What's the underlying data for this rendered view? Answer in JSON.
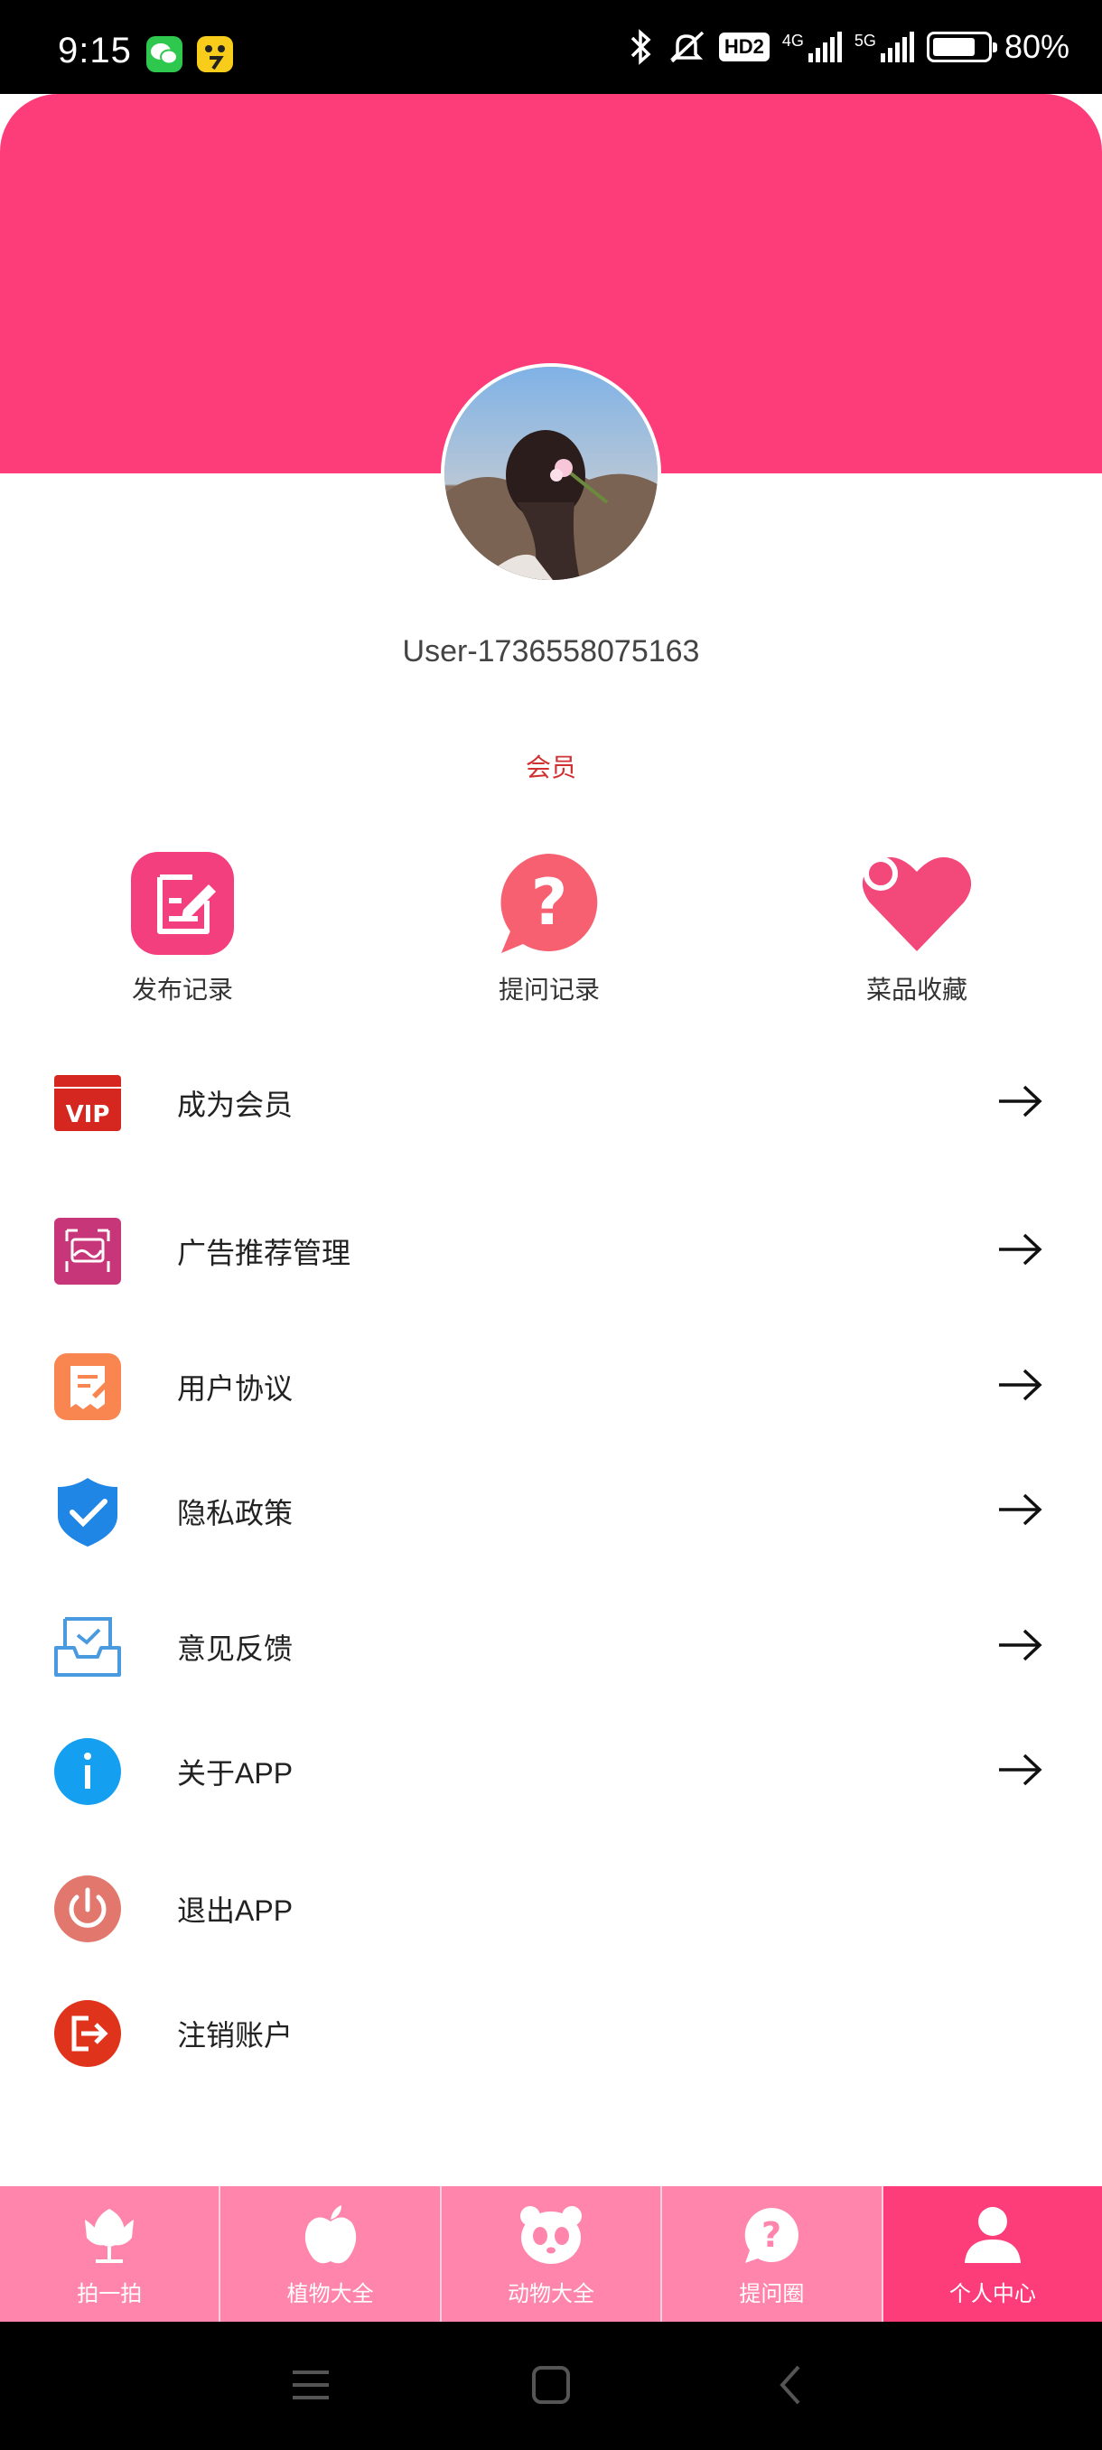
{
  "status_bar": {
    "time": "9:15",
    "net1": "4G",
    "net2": "5G",
    "hd": "HD2",
    "battery_percent": 80,
    "battery_text": "80%"
  },
  "profile": {
    "username": "User-1736558075163",
    "member_label": "会员"
  },
  "quick_actions": [
    {
      "label": "发布记录",
      "icon": "edit-note-icon",
      "color": "#f33f7d"
    },
    {
      "label": "提问记录",
      "icon": "question-bubble-icon",
      "color": "#f76071"
    },
    {
      "label": "菜品收藏",
      "icon": "heart-icon",
      "color": "#f2487a"
    }
  ],
  "menu": [
    {
      "label": "成为会员",
      "icon": "vip-icon",
      "arrow": true
    },
    {
      "label": "广告推荐管理",
      "icon": "ad-recommend-icon",
      "arrow": true
    },
    {
      "label": "用户协议",
      "icon": "agreement-icon",
      "arrow": true
    },
    {
      "label": "隐私政策",
      "icon": "shield-check-icon",
      "arrow": true
    },
    {
      "label": "意见反馈",
      "icon": "feedback-inbox-icon",
      "arrow": true
    },
    {
      "label": "关于APP",
      "icon": "info-icon",
      "arrow": true
    },
    {
      "label": "退出APP",
      "icon": "power-icon",
      "arrow": false
    },
    {
      "label": "注销账户",
      "icon": "logout-icon",
      "arrow": false
    }
  ],
  "tabs": [
    {
      "label": "拍一拍",
      "icon": "tulip-icon",
      "active": false
    },
    {
      "label": "植物大全",
      "icon": "apple-icon",
      "active": false
    },
    {
      "label": "动物大全",
      "icon": "panda-icon",
      "active": false
    },
    {
      "label": "提问圈",
      "icon": "question-bubble-icon",
      "active": false
    },
    {
      "label": "个人中心",
      "icon": "person-icon",
      "active": true
    }
  ],
  "colors": {
    "brand": "#fd3d7a",
    "tab_inactive": "#ff85ad",
    "member_tag": "#d03030"
  }
}
